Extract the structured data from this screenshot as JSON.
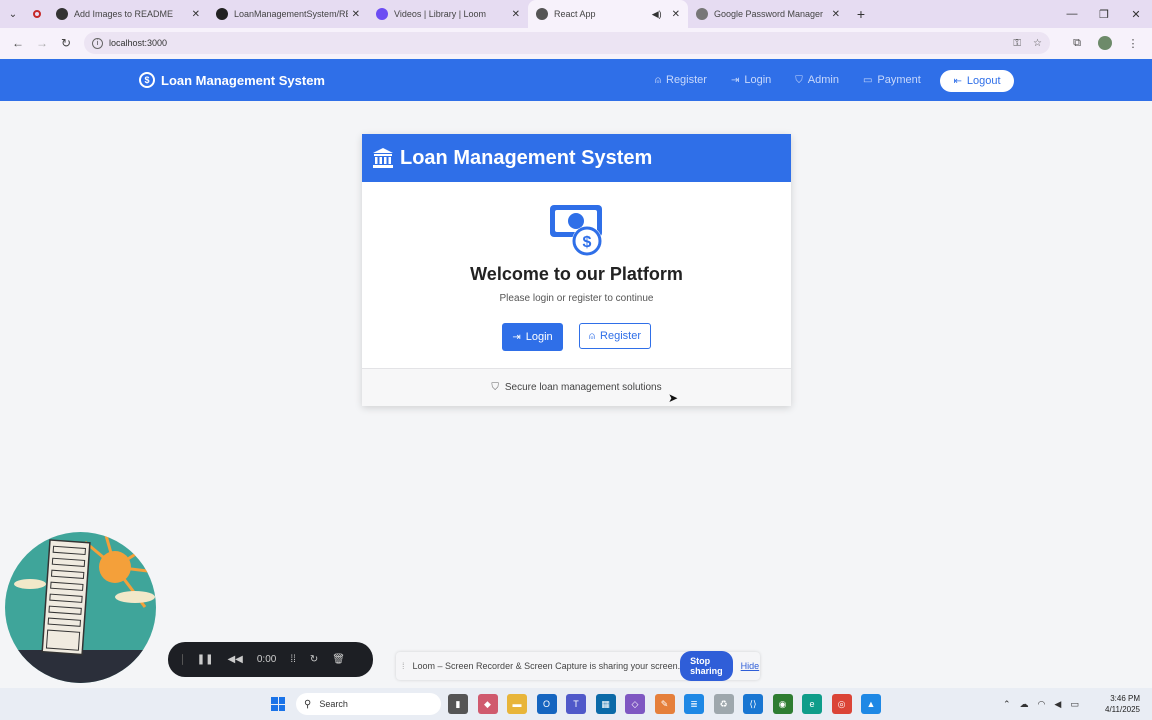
{
  "browser": {
    "tabs": [
      {
        "title": "Add Images to README",
        "favicon_color": "#333333"
      },
      {
        "title": "LoanManagementSystem/READ",
        "favicon_color": "#222222"
      },
      {
        "title": "Videos | Library | Loom",
        "favicon_color": "#6c4cf3"
      },
      {
        "title": "React App",
        "favicon_color": "#555555",
        "active": true
      },
      {
        "title": "Google Password Manager",
        "favicon_color": "#777777"
      }
    ],
    "url": "localhost:3000"
  },
  "app": {
    "brand": "Loan Management System",
    "nav": {
      "register": "Register",
      "login": "Login",
      "admin": "Admin",
      "payment": "Payment",
      "logout": "Logout"
    },
    "card": {
      "header": "Loan Management System",
      "welcome": "Welcome to our Platform",
      "subtitle": "Please login or register to continue",
      "login_btn": "Login",
      "register_btn": "Register",
      "footer": "Secure loan management solutions"
    },
    "colors": {
      "primary": "#2f6fe8"
    }
  },
  "loom": {
    "timer": "0:00",
    "share_message": "Loom – Screen Recorder & Screen Capture is sharing your screen.",
    "stop_sharing": "Stop sharing",
    "hide": "Hide"
  },
  "taskbar": {
    "search_placeholder": "Search",
    "time": "3:46 PM",
    "date": "4/11/2025"
  }
}
